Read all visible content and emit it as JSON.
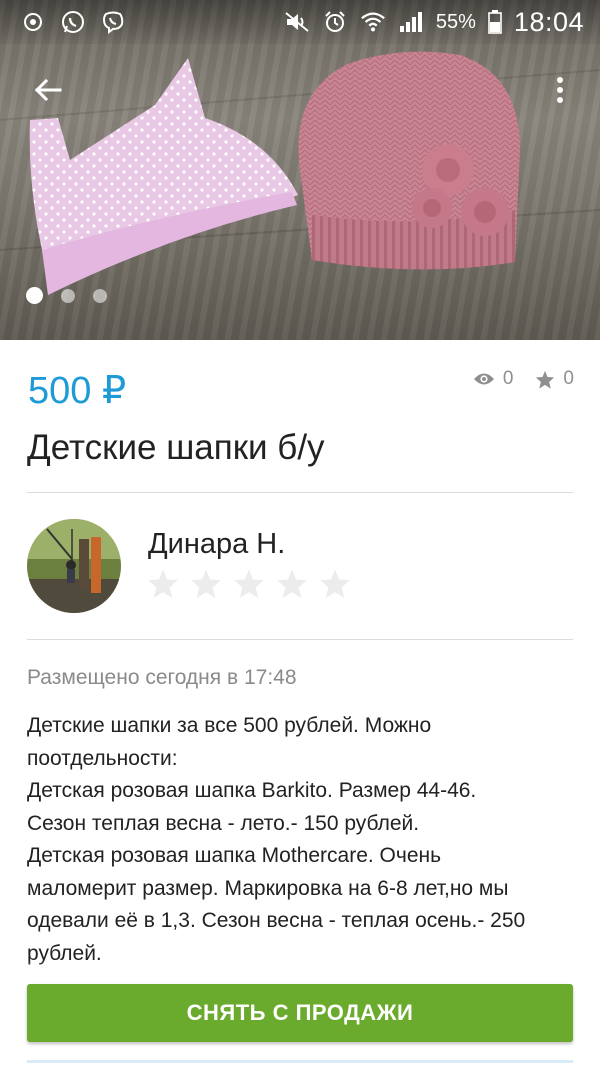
{
  "status_bar": {
    "battery_percent": "55%",
    "time": "18:04",
    "icons": [
      "notification-circle-icon",
      "whatsapp-icon",
      "viber-icon",
      "mute-icon",
      "alarm-icon",
      "wifi-icon",
      "signal-icon",
      "battery-icon"
    ]
  },
  "gallery": {
    "image_count": 3,
    "active_index": 0
  },
  "listing": {
    "price": "500 ₽",
    "views": "0",
    "favorites": "0",
    "title": "Детские шапки б/у"
  },
  "seller": {
    "name": "Динара Н.",
    "rating_stars": 0,
    "rating_max": 5
  },
  "posted": "Размещено сегодня в 17:48",
  "description_lines": [
    "Детские шапки за все 500 рублей. Можно",
    "поотдельности:",
    "Детская розовая шапка Barkito. Размер 44-46.",
    "Сезон теплая весна - лето.- 150 рублей.",
    "Детская розовая шапка Mothercare. Очень",
    "маломерит размер. Маркировка на 6-8 лет,но мы",
    "одевали её в 1,3. Сезон весна - теплая осень.- 250",
    "рублей."
  ],
  "action_button": "СНЯТЬ С ПРОДАЖИ",
  "colors": {
    "price": "#1e9ad6",
    "action": "#6aaa2c"
  }
}
